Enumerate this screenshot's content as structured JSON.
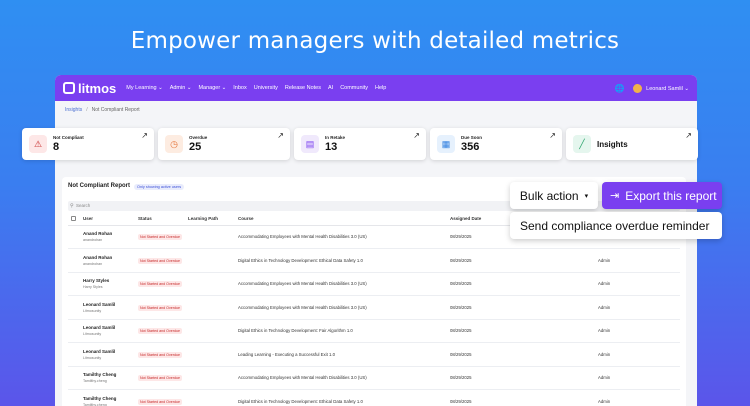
{
  "headline": "Empower managers with detailed metrics",
  "nav": {
    "logo": "litmos",
    "items": [
      "My Learning ⌄",
      "Admin ⌄",
      "Manager ⌄",
      "Inbox",
      "University",
      "Release Notes",
      "AI",
      "Community",
      "Help"
    ],
    "user": "Leonard Samlil ⌄",
    "globe_icon": "globe-icon"
  },
  "breadcrumb": {
    "root": "Insights",
    "sep": "/",
    "current": "Not Compliant Report"
  },
  "cards": [
    {
      "label": "Not Compliant",
      "value": "8",
      "icon": "⚠",
      "icon_name": "warning-icon",
      "color": "#fde7e7",
      "fg": "#c62828"
    },
    {
      "label": "Overdue",
      "value": "25",
      "icon": "◷",
      "icon_name": "clock-icon",
      "color": "#fdece1",
      "fg": "#e5743a"
    },
    {
      "label": "In Retake",
      "value": "13",
      "icon": "▤",
      "icon_name": "book-icon",
      "color": "#f0e9fc",
      "fg": "#7a3ff0"
    },
    {
      "label": "Due Soon",
      "value": "356",
      "icon": "▦",
      "icon_name": "calendar-icon",
      "color": "#e6f1fd",
      "fg": "#2f7fe0"
    }
  ],
  "insights_card": {
    "label": "Insights",
    "icon": "╱",
    "icon_name": "chart-line-icon",
    "color": "#e5f6ee",
    "fg": "#2aa36b"
  },
  "card_arrow": "↗",
  "panel": {
    "title": "Not Compliant Report",
    "badge": "Only showing active users",
    "search_placeholder": "Search"
  },
  "table": {
    "headers": [
      "User",
      "Status",
      "Learning Path",
      "Course",
      "Assigned Date",
      ""
    ],
    "rows": [
      {
        "name": "Anand Rohan",
        "sub": "anandrohan",
        "status": "Not Started and Overdue",
        "path": "",
        "course": "Accommodating Employees with Mental Health Disabilities 3.0 (US)",
        "date": "08/29/2025",
        "by": ""
      },
      {
        "name": "Anand Rohan",
        "sub": "anandrohan",
        "status": "Not Started and Overdue",
        "path": "",
        "course": "Digital Ethics in Technology Development: Ethical Data Safety 1.0",
        "date": "08/29/2025",
        "by": "Admin"
      },
      {
        "name": "Harry Styles",
        "sub": "Harry Styles",
        "status": "Not Started and Overdue",
        "path": "",
        "course": "Accommodating Employees with Mental Health Disabilities 3.0 (US)",
        "date": "08/29/2025",
        "by": "Admin"
      },
      {
        "name": "Leonard Samlil",
        "sub": "Litmosunity",
        "status": "Not Started and Overdue",
        "path": "",
        "course": "Accommodating Employees with Mental Health Disabilities 3.0 (US)",
        "date": "08/29/2025",
        "by": "Admin"
      },
      {
        "name": "Leonard Samlil",
        "sub": "Litmosunity",
        "status": "Not Started and Overdue",
        "path": "",
        "course": "Digital Ethics in Technology Development: Fair Algorithm 1.0",
        "date": "08/29/2025",
        "by": "Admin"
      },
      {
        "name": "Leonard Samlil",
        "sub": "Litmosunity",
        "status": "Not Started and Overdue",
        "path": "",
        "course": "Leading Learning - Executing a Successful Exit 1.0",
        "date": "08/29/2025",
        "by": "Admin"
      },
      {
        "name": "Tamilthy Cheng",
        "sub": "Tamilthy.cheng",
        "status": "Not Started and Overdue",
        "path": "",
        "course": "Accommodating Employees with Mental Health Disabilities 3.0 (US)",
        "date": "08/29/2025",
        "by": "Admin"
      },
      {
        "name": "Tamilthy Cheng",
        "sub": "Tamilthy.cheng",
        "status": "Not Started and Overdue",
        "path": "",
        "course": "Digital Ethics in Technology Development: Ethical Data Safety 1.0",
        "date": "08/29/2025",
        "by": "Admin"
      }
    ]
  },
  "actions": {
    "bulk_label": "Bulk action",
    "bulk_caret": "▾",
    "export_label": "Export this report",
    "export_icon": "⇥",
    "reminder_label": "Send compliance overdue reminder"
  }
}
